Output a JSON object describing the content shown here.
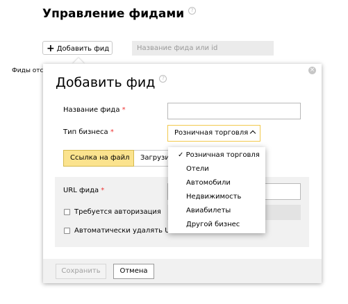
{
  "page": {
    "title": "Управление фидами",
    "help_glyph": "?",
    "add_button_label": "Добавить фид",
    "add_button_icon": "+",
    "search_placeholder": "Название фида или id",
    "feeds_label": "Фиды отс"
  },
  "modal": {
    "title": "Добавить фид",
    "help_glyph": "?",
    "close_glyph": "×",
    "name_label": "Название фида",
    "type_label": "Тип бизнеса",
    "required_mark": "*",
    "name_value": "",
    "type_value": "Розничная торговля",
    "tabs": [
      {
        "label": "Ссылка на файл",
        "active": true
      },
      {
        "label": "Загрузи",
        "active": false
      }
    ],
    "url_label": "URL фида",
    "url_value": "",
    "auth_label": "Требуется авторизация",
    "autodelete_label": "Автоматически удалять UT",
    "save_label": "Сохранить",
    "cancel_label": "Отмена"
  },
  "dropdown": {
    "checkmark": "✓",
    "options": [
      {
        "label": "Розничная торговля",
        "selected": true
      },
      {
        "label": "Отели",
        "selected": false
      },
      {
        "label": "Автомобили",
        "selected": false
      },
      {
        "label": "Недвижимость",
        "selected": false
      },
      {
        "label": "Авиабилеты",
        "selected": false
      },
      {
        "label": "Другой бизнес",
        "selected": false
      }
    ]
  },
  "colors": {
    "active_tab": "#fbe38e",
    "required": "#ee3333",
    "select_border": "#f2c94c"
  }
}
